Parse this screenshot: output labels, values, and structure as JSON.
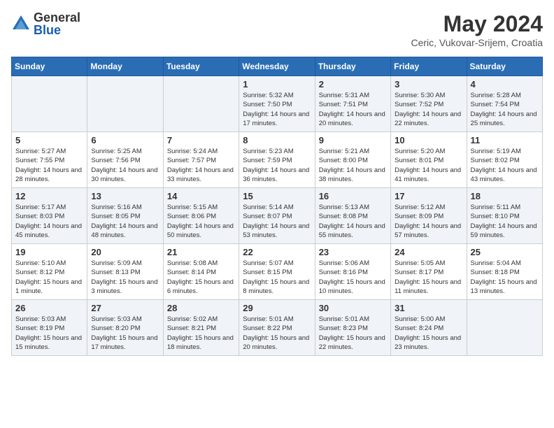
{
  "logo": {
    "general": "General",
    "blue": "Blue"
  },
  "title": {
    "month": "May 2024",
    "location": "Ceric, Vukovar-Srijem, Croatia"
  },
  "weekdays": [
    "Sunday",
    "Monday",
    "Tuesday",
    "Wednesday",
    "Thursday",
    "Friday",
    "Saturday"
  ],
  "weeks": [
    [
      {
        "day": "",
        "info": ""
      },
      {
        "day": "",
        "info": ""
      },
      {
        "day": "",
        "info": ""
      },
      {
        "day": "1",
        "info": "Sunrise: 5:32 AM\nSunset: 7:50 PM\nDaylight: 14 hours\nand 17 minutes."
      },
      {
        "day": "2",
        "info": "Sunrise: 5:31 AM\nSunset: 7:51 PM\nDaylight: 14 hours\nand 20 minutes."
      },
      {
        "day": "3",
        "info": "Sunrise: 5:30 AM\nSunset: 7:52 PM\nDaylight: 14 hours\nand 22 minutes."
      },
      {
        "day": "4",
        "info": "Sunrise: 5:28 AM\nSunset: 7:54 PM\nDaylight: 14 hours\nand 25 minutes."
      }
    ],
    [
      {
        "day": "5",
        "info": "Sunrise: 5:27 AM\nSunset: 7:55 PM\nDaylight: 14 hours\nand 28 minutes."
      },
      {
        "day": "6",
        "info": "Sunrise: 5:25 AM\nSunset: 7:56 PM\nDaylight: 14 hours\nand 30 minutes."
      },
      {
        "day": "7",
        "info": "Sunrise: 5:24 AM\nSunset: 7:57 PM\nDaylight: 14 hours\nand 33 minutes."
      },
      {
        "day": "8",
        "info": "Sunrise: 5:23 AM\nSunset: 7:59 PM\nDaylight: 14 hours\nand 36 minutes."
      },
      {
        "day": "9",
        "info": "Sunrise: 5:21 AM\nSunset: 8:00 PM\nDaylight: 14 hours\nand 38 minutes."
      },
      {
        "day": "10",
        "info": "Sunrise: 5:20 AM\nSunset: 8:01 PM\nDaylight: 14 hours\nand 41 minutes."
      },
      {
        "day": "11",
        "info": "Sunrise: 5:19 AM\nSunset: 8:02 PM\nDaylight: 14 hours\nand 43 minutes."
      }
    ],
    [
      {
        "day": "12",
        "info": "Sunrise: 5:17 AM\nSunset: 8:03 PM\nDaylight: 14 hours\nand 45 minutes."
      },
      {
        "day": "13",
        "info": "Sunrise: 5:16 AM\nSunset: 8:05 PM\nDaylight: 14 hours\nand 48 minutes."
      },
      {
        "day": "14",
        "info": "Sunrise: 5:15 AM\nSunset: 8:06 PM\nDaylight: 14 hours\nand 50 minutes."
      },
      {
        "day": "15",
        "info": "Sunrise: 5:14 AM\nSunset: 8:07 PM\nDaylight: 14 hours\nand 53 minutes."
      },
      {
        "day": "16",
        "info": "Sunrise: 5:13 AM\nSunset: 8:08 PM\nDaylight: 14 hours\nand 55 minutes."
      },
      {
        "day": "17",
        "info": "Sunrise: 5:12 AM\nSunset: 8:09 PM\nDaylight: 14 hours\nand 57 minutes."
      },
      {
        "day": "18",
        "info": "Sunrise: 5:11 AM\nSunset: 8:10 PM\nDaylight: 14 hours\nand 59 minutes."
      }
    ],
    [
      {
        "day": "19",
        "info": "Sunrise: 5:10 AM\nSunset: 8:12 PM\nDaylight: 15 hours\nand 1 minute."
      },
      {
        "day": "20",
        "info": "Sunrise: 5:09 AM\nSunset: 8:13 PM\nDaylight: 15 hours\nand 3 minutes."
      },
      {
        "day": "21",
        "info": "Sunrise: 5:08 AM\nSunset: 8:14 PM\nDaylight: 15 hours\nand 6 minutes."
      },
      {
        "day": "22",
        "info": "Sunrise: 5:07 AM\nSunset: 8:15 PM\nDaylight: 15 hours\nand 8 minutes."
      },
      {
        "day": "23",
        "info": "Sunrise: 5:06 AM\nSunset: 8:16 PM\nDaylight: 15 hours\nand 10 minutes."
      },
      {
        "day": "24",
        "info": "Sunrise: 5:05 AM\nSunset: 8:17 PM\nDaylight: 15 hours\nand 11 minutes."
      },
      {
        "day": "25",
        "info": "Sunrise: 5:04 AM\nSunset: 8:18 PM\nDaylight: 15 hours\nand 13 minutes."
      }
    ],
    [
      {
        "day": "26",
        "info": "Sunrise: 5:03 AM\nSunset: 8:19 PM\nDaylight: 15 hours\nand 15 minutes."
      },
      {
        "day": "27",
        "info": "Sunrise: 5:03 AM\nSunset: 8:20 PM\nDaylight: 15 hours\nand 17 minutes."
      },
      {
        "day": "28",
        "info": "Sunrise: 5:02 AM\nSunset: 8:21 PM\nDaylight: 15 hours\nand 18 minutes."
      },
      {
        "day": "29",
        "info": "Sunrise: 5:01 AM\nSunset: 8:22 PM\nDaylight: 15 hours\nand 20 minutes."
      },
      {
        "day": "30",
        "info": "Sunrise: 5:01 AM\nSunset: 8:23 PM\nDaylight: 15 hours\nand 22 minutes."
      },
      {
        "day": "31",
        "info": "Sunrise: 5:00 AM\nSunset: 8:24 PM\nDaylight: 15 hours\nand 23 minutes."
      },
      {
        "day": "",
        "info": ""
      }
    ]
  ]
}
